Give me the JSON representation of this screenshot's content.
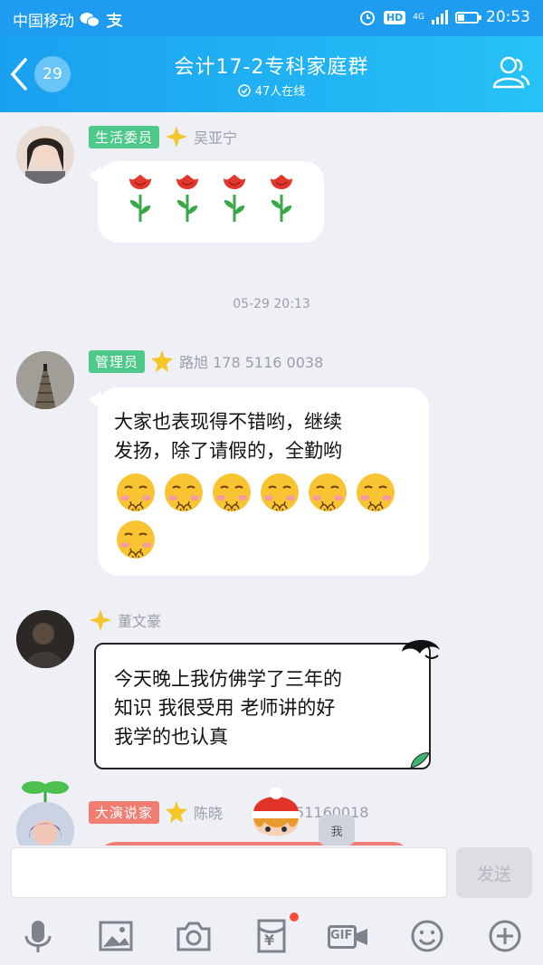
{
  "status": {
    "carrier": "中国移动",
    "time": "20:53",
    "hd": "HD",
    "network": "4G"
  },
  "header": {
    "unread_count": "29",
    "title": "会计17-2专科家庭群",
    "online": "47人在线"
  },
  "messages": [
    {
      "tag": "生活委员",
      "tag_color": "#4fc98a",
      "name": "吴亚宁",
      "content_type": "roses",
      "rose_count": 4
    },
    {
      "timestamp": "05-29 20:13"
    },
    {
      "tag": "管理员",
      "tag_color": "#4fc98a",
      "name": "路旭 178 5116 0038",
      "text_line1": "大家也表现得不错哟，继续",
      "text_line2": "发扬，除了请假的，全勤哟",
      "emoji_count": 7
    },
    {
      "name": "董文豪",
      "text_line1": "今天晚上我仿佛学了三年的",
      "text_line2": "知识 我很受用 老师讲的好",
      "text_line3": "我学的也认真"
    },
    {
      "tag": "大演说家",
      "tag_color": "#f07d72",
      "name": "陈晓",
      "name_suffix": "51160018",
      "sticker_label": "我"
    }
  ],
  "input": {
    "placeholder": "",
    "send_label": "发送"
  },
  "toolbar": {
    "icons": [
      "microphone-icon",
      "image-icon",
      "camera-icon",
      "red-packet-icon",
      "gif-icon",
      "emoji-icon",
      "plus-icon"
    ],
    "gif_label": "GIF",
    "yen_label": "¥"
  },
  "colors": {
    "accent": "#1e9cf0",
    "tag_green": "#4fc98a",
    "tag_red": "#f07d72"
  }
}
